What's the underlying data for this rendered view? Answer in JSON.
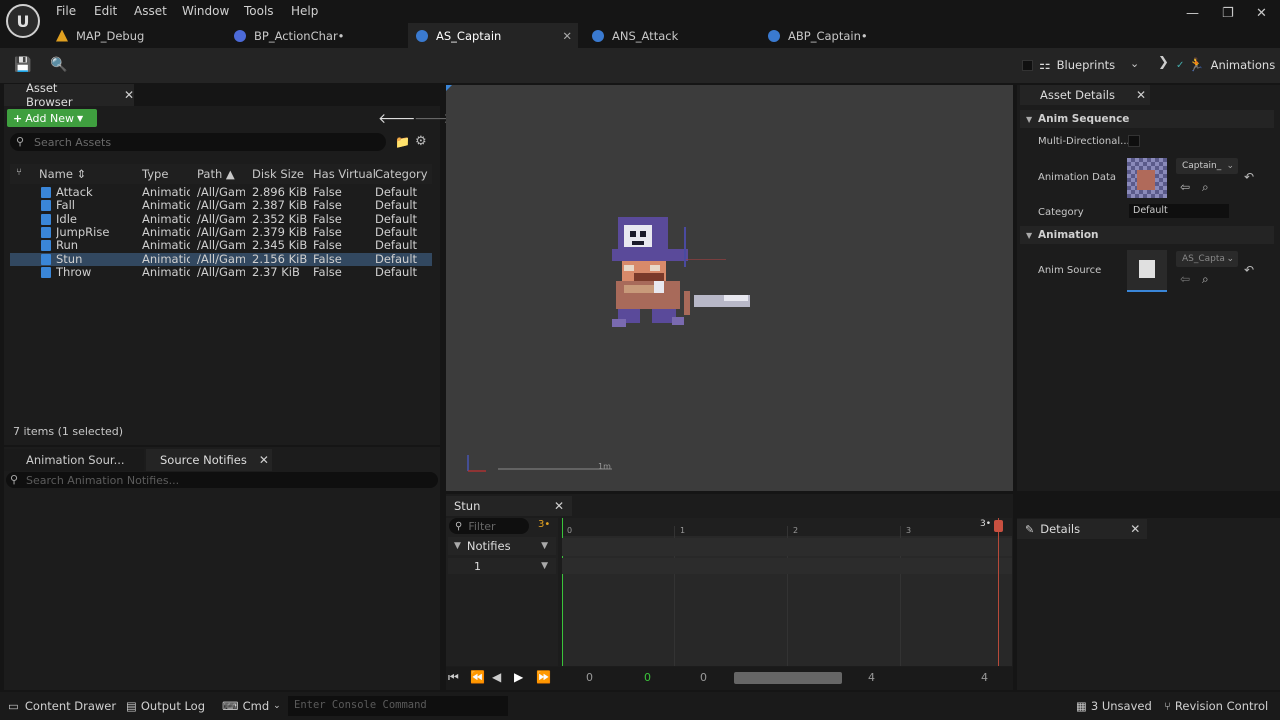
{
  "menu": [
    "File",
    "Edit",
    "Asset",
    "Window",
    "Tools",
    "Help"
  ],
  "doc_tabs": [
    {
      "label": "MAP_Debug"
    },
    {
      "label": "BP_ActionChar•"
    },
    {
      "label": "AS_Captain"
    },
    {
      "label": "ANS_Attack"
    },
    {
      "label": "ABP_Captain•"
    }
  ],
  "toolbar": {
    "blueprints_label": "Blueprints",
    "animations_label": "Animations"
  },
  "asset_browser": {
    "title": "Asset Browser",
    "add_new": "Add New",
    "search_placeholder": "Search Assets",
    "columns": [
      "Name",
      "Type",
      "Path",
      "Disk Size",
      "Has Virtual",
      "Category"
    ],
    "rows": [
      {
        "name": "Attack",
        "type": "Animatio",
        "path": "/All/Gam",
        "size": "2.896 KiB",
        "virtual": "False",
        "category": "Default"
      },
      {
        "name": "Fall",
        "type": "Animatio",
        "path": "/All/Gam",
        "size": "2.387 KiB",
        "virtual": "False",
        "category": "Default"
      },
      {
        "name": "Idle",
        "type": "Animatio",
        "path": "/All/Gam",
        "size": "2.352 KiB",
        "virtual": "False",
        "category": "Default"
      },
      {
        "name": "JumpRise",
        "type": "Animatio",
        "path": "/All/Gam",
        "size": "2.379 KiB",
        "virtual": "False",
        "category": "Default"
      },
      {
        "name": "Run",
        "type": "Animatio",
        "path": "/All/Gam",
        "size": "2.345 KiB",
        "virtual": "False",
        "category": "Default"
      },
      {
        "name": "Stun",
        "type": "Animatio",
        "path": "/All/Gam",
        "size": "2.156 KiB",
        "virtual": "False",
        "category": "Default"
      },
      {
        "name": "Throw",
        "type": "Animatio",
        "path": "/All/Gam",
        "size": "2.37 KiB",
        "virtual": "False",
        "category": "Default"
      }
    ],
    "item_count": "7 items (1 selected)"
  },
  "notifies_panel": {
    "tab1": "Animation Sour...",
    "tab2": "Source Notifies",
    "search_placeholder": "Search Animation Notifies..."
  },
  "viewport": {
    "scale_label": "1m"
  },
  "timeline": {
    "tab_title": "Stun",
    "filter_placeholder": "Filter",
    "filter_count": "3•",
    "notifies_label": "Notifies",
    "track_number": "1",
    "ruler_marks": [
      "0",
      "1",
      "2",
      "3"
    ],
    "frame_marker": "3•",
    "controls_values": [
      "0",
      "0",
      "0",
      "4",
      "4"
    ]
  },
  "asset_details": {
    "title": "Asset Details",
    "section_anim_sequence": "Anim Sequence",
    "multi_directional_label": "Multi-Directional...",
    "animation_data_label": "Animation Data",
    "animation_data_value": "Captain_",
    "category_label": "Category",
    "category_value": "Default",
    "section_animation": "Animation",
    "anim_source_label": "Anim Source",
    "anim_source_value": "AS_Capta"
  },
  "details_panel": {
    "title": "Details"
  },
  "statusbar": {
    "content_drawer": "Content Drawer",
    "output_log": "Output Log",
    "cmd": "Cmd",
    "console_placeholder": "Enter Console Command",
    "unsaved": "3 Unsaved",
    "revision_control": "Revision Control"
  }
}
